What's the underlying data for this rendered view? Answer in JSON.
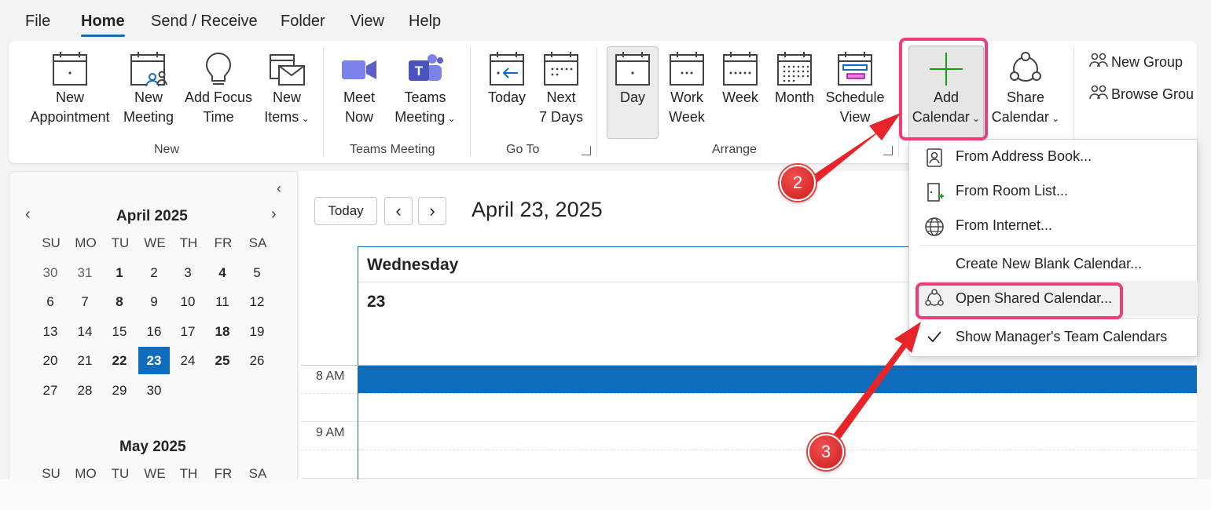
{
  "tabs": [
    {
      "label": "File"
    },
    {
      "label": "Home"
    },
    {
      "label": "Send / Receive"
    },
    {
      "label": "Folder"
    },
    {
      "label": "View"
    },
    {
      "label": "Help"
    }
  ],
  "ribbon": {
    "new_appointment": {
      "line1": "New",
      "line2": "Appointment"
    },
    "new_meeting": {
      "line1": "New",
      "line2": "Meeting"
    },
    "add_focus_time": {
      "line1": "Add Focus",
      "line2": "Time"
    },
    "new_items": {
      "line1": "New",
      "line2": "Items"
    },
    "group_new": "New",
    "meet_now": {
      "line1": "Meet",
      "line2": "Now"
    },
    "teams_meeting": {
      "line1": "Teams",
      "line2": "Meeting"
    },
    "group_teams": "Teams Meeting",
    "today": {
      "line1": "Today"
    },
    "next7": {
      "line1": "Next",
      "line2": "7 Days"
    },
    "group_goto": "Go To",
    "day": {
      "line1": "Day"
    },
    "work_week": {
      "line1": "Work",
      "line2": "Week"
    },
    "week": {
      "line1": "Week"
    },
    "month": {
      "line1": "Month"
    },
    "schedule_view": {
      "line1": "Schedule",
      "line2": "View"
    },
    "group_arrange": "Arrange",
    "add_calendar": {
      "line1": "Add",
      "line2": "Calendar"
    },
    "share_calendar": {
      "line1": "Share",
      "line2": "Calendar"
    },
    "new_group": "New Group",
    "browse_groups": "Browse Grou"
  },
  "minical": {
    "april": {
      "title": "April 2025",
      "dow": [
        "SU",
        "MO",
        "TU",
        "WE",
        "TH",
        "FR",
        "SA"
      ],
      "weeks": [
        [
          "30",
          "31",
          "1",
          "2",
          "3",
          "4",
          "5"
        ],
        [
          "6",
          "7",
          "8",
          "9",
          "10",
          "11",
          "12"
        ],
        [
          "13",
          "14",
          "15",
          "16",
          "17",
          "18",
          "19"
        ],
        [
          "20",
          "21",
          "22",
          "23",
          "24",
          "25",
          "26"
        ],
        [
          "27",
          "28",
          "29",
          "30",
          "",
          "",
          ""
        ]
      ]
    },
    "may": {
      "title": "May 2025",
      "dow": [
        "SU",
        "MO",
        "TU",
        "WE",
        "TH",
        "FR",
        "SA"
      ]
    }
  },
  "main": {
    "today_button": "Today",
    "date_title": "April 23, 2025",
    "day_name": "Wednesday",
    "day_number": "23",
    "times": [
      "8 AM",
      "9 AM"
    ]
  },
  "menu": {
    "items": [
      "From Address Book...",
      "From Room List...",
      "From Internet...",
      "Create New Blank Calendar...",
      "Open Shared Calendar...",
      "Show Manager's Team Calendars"
    ]
  },
  "annotations": {
    "step2": "2",
    "step3": "3"
  },
  "colors": {
    "accent": "#0f6cbd",
    "highlight": "#ee3d7a",
    "arrow": "#e8242b"
  }
}
